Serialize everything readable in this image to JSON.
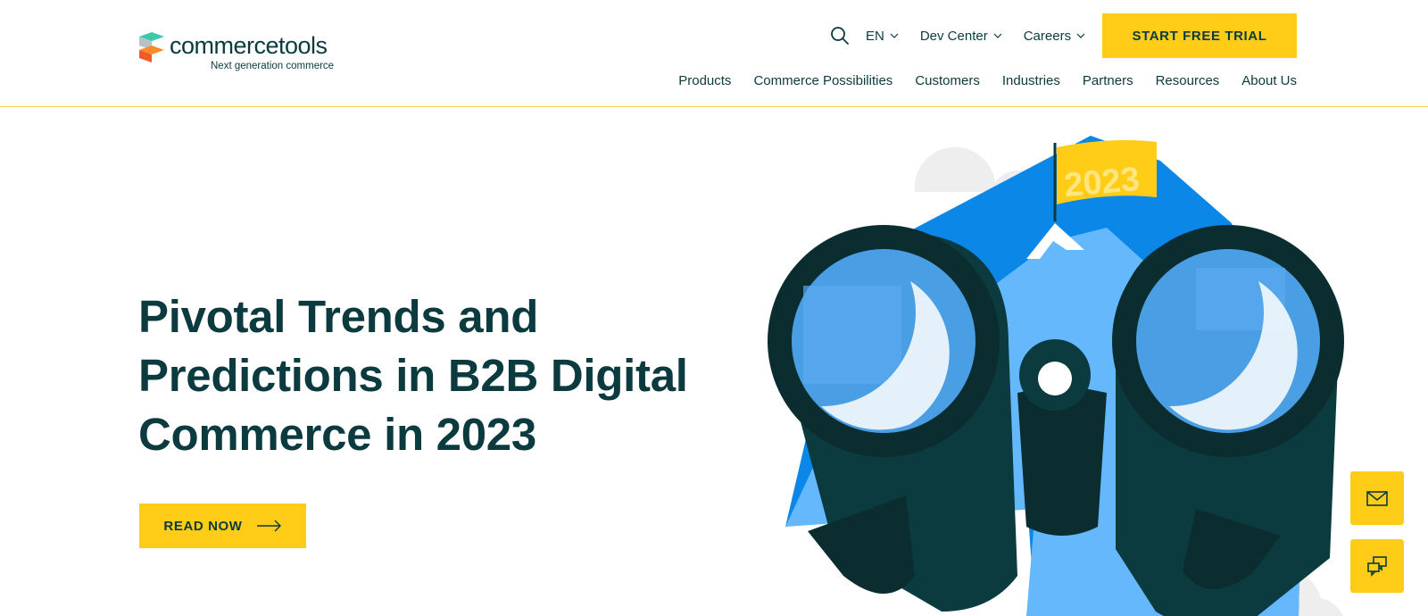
{
  "header": {
    "logo": {
      "name": "commercetools",
      "tagline": "Next generation commerce"
    },
    "utility": {
      "language": "EN",
      "dev_center": "Dev Center",
      "careers": "Careers"
    },
    "cta_label": "START FREE TRIAL",
    "nav": [
      {
        "label": "Products"
      },
      {
        "label": "Commerce Possibilities"
      },
      {
        "label": "Customers"
      },
      {
        "label": "Industries"
      },
      {
        "label": "Partners"
      },
      {
        "label": "Resources"
      },
      {
        "label": "About Us"
      }
    ]
  },
  "hero": {
    "title_lines": [
      "Pivotal Trends and",
      "Predictions in B2B Digital",
      "Commerce in 2023"
    ],
    "button_label": "READ NOW",
    "flag_text": "2023"
  },
  "floating": {
    "email_icon": "envelope-icon",
    "chat_icon": "chat-bubbles-icon"
  },
  "colors": {
    "brand_dark": "#0b3a3f",
    "accent_yellow": "#ffcd17",
    "sky_blue": "#0b87e8",
    "light_blue": "#64b8fb"
  }
}
